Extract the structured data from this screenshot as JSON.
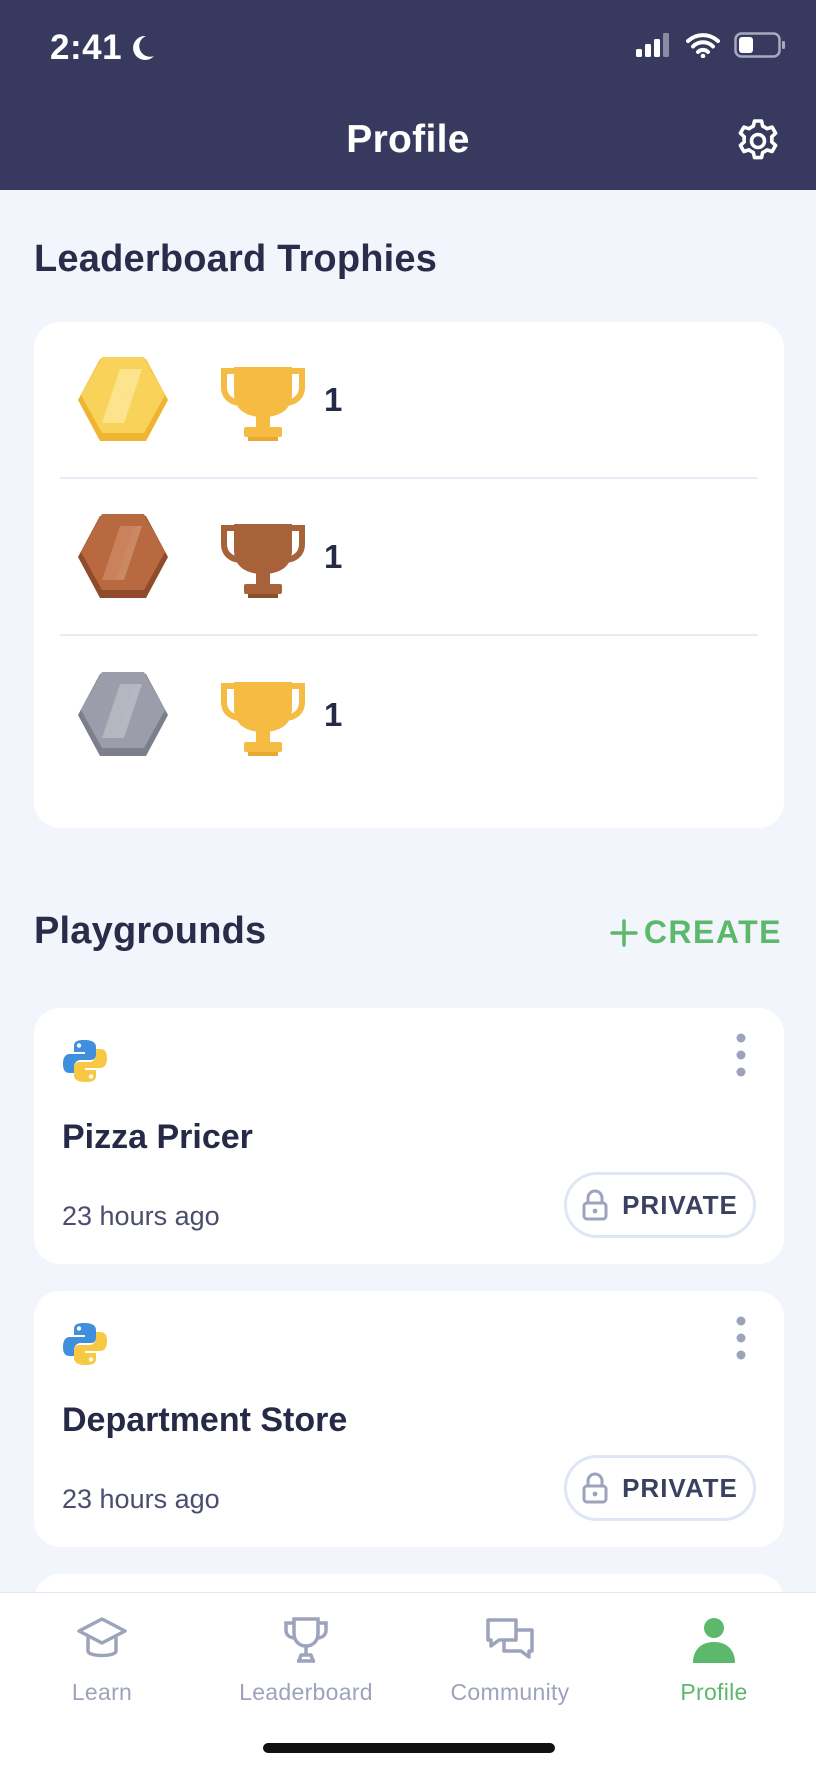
{
  "status_bar": {
    "time": "2:41"
  },
  "header": {
    "title": "Profile"
  },
  "trophies": {
    "title": "Leaderboard Trophies",
    "rows": [
      {
        "badge": "gold-badge",
        "cup": "gold-cup",
        "count": "1",
        "badge_color": "#f7c843",
        "cup_color": "#f6bb42"
      },
      {
        "badge": "bronze-badge",
        "cup": "bronze-cup",
        "count": "1",
        "badge_color": "#b8693f",
        "cup_color": "#a86239"
      },
      {
        "badge": "silver-badge",
        "cup": "gold-cup",
        "count": "1",
        "badge_color": "#9b9eaa",
        "cup_color": "#f6bb42"
      }
    ]
  },
  "playgrounds": {
    "title": "Playgrounds",
    "create_label": "CREATE",
    "items": [
      {
        "name": "Pizza Pricer",
        "time": "23 hours ago",
        "visibility": "PRIVATE",
        "language_icon": "python-icon"
      },
      {
        "name": "Department Store",
        "time": "23 hours ago",
        "visibility": "PRIVATE",
        "language_icon": "python-icon"
      }
    ]
  },
  "tabbar": {
    "items": [
      {
        "label": "Learn",
        "icon": "graduation-cap-icon"
      },
      {
        "label": "Leaderboard",
        "icon": "trophy-icon"
      },
      {
        "label": "Community",
        "icon": "chat-bubbles-icon"
      },
      {
        "label": "Profile",
        "icon": "person-icon"
      }
    ],
    "active": "Profile"
  },
  "colors": {
    "header_bg": "#373a5e",
    "accent_green": "#5cb86a",
    "page_bg": "#f2f5fc"
  }
}
